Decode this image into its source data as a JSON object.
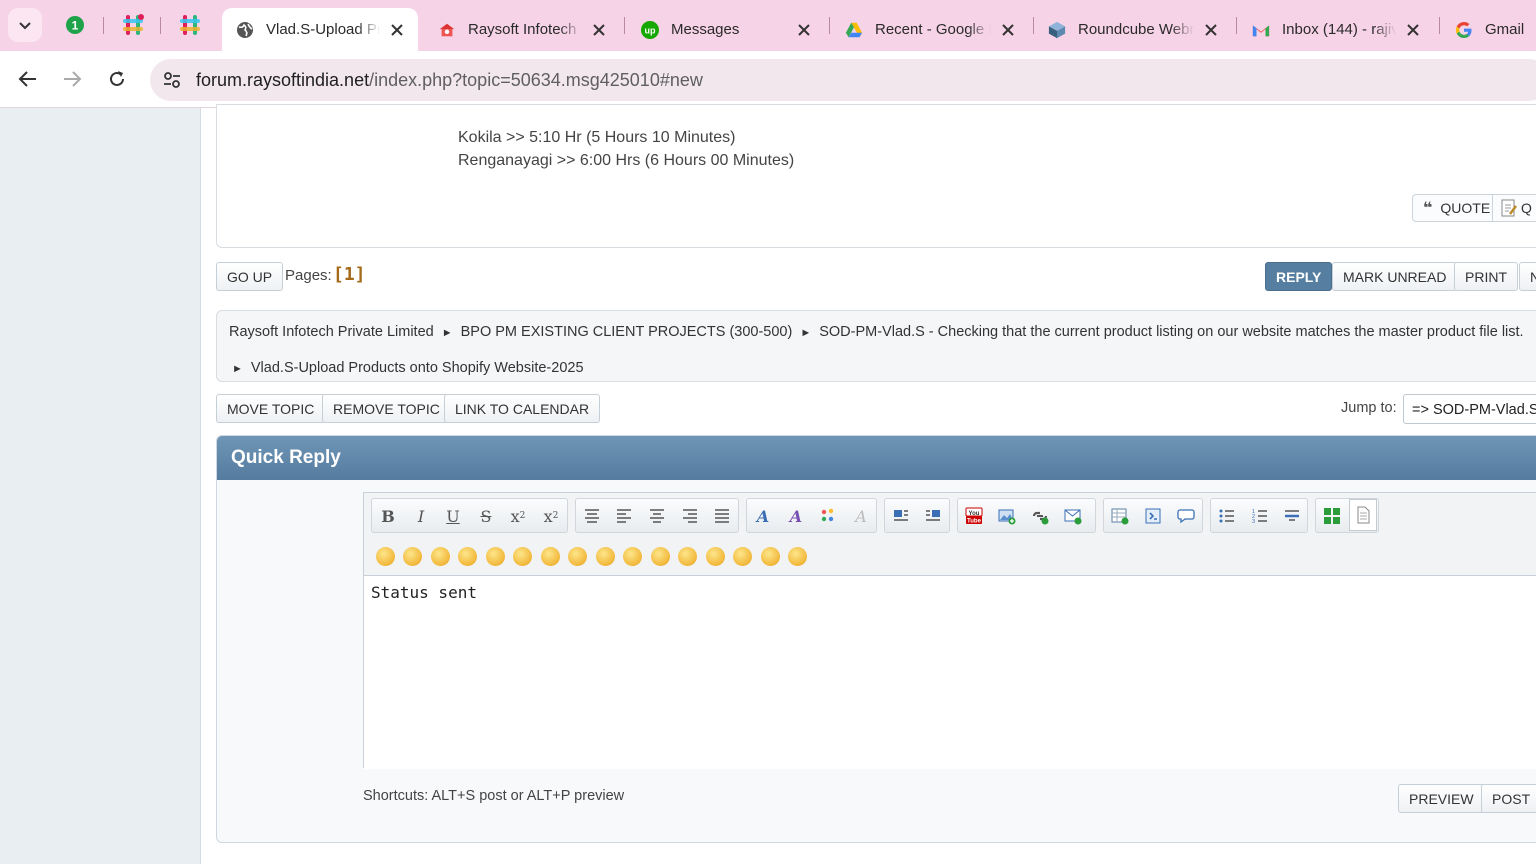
{
  "browser": {
    "tabs": [
      {
        "title": "Vlad.S-Upload Pr",
        "favicon": "globe-icon",
        "active": true
      },
      {
        "title": "Raysoft Infotech I",
        "favicon": "raysoft-icon"
      },
      {
        "title": "Messages",
        "favicon": "upwork-icon"
      },
      {
        "title": "Recent - Google D",
        "favicon": "drive-icon"
      },
      {
        "title": "Roundcube Webr",
        "favicon": "roundcube-icon"
      },
      {
        "title": "Inbox (144) - rajiv",
        "favicon": "gmail-icon"
      },
      {
        "title": "Gmail",
        "favicon": "google-icon"
      }
    ],
    "url_host": "forum.raysoftindia.net",
    "url_rest": "/index.php?topic=50634.msg425010#new"
  },
  "post": {
    "lines": [
      "Kokila >>  5:10 Hr (5 Hours 10 Minutes)",
      "Renganayagi >> 6:00 Hrs (6 Hours 00 Minutes)"
    ],
    "quote_label": "QUOTE",
    "quote2_label": "Q"
  },
  "nav": {
    "go_up": "GO UP",
    "pages_label": "Pages:",
    "pages_value": "[1]",
    "reply": "REPLY",
    "mark_unread": "MARK UNREAD",
    "print": "PRINT",
    "more": "N"
  },
  "breadcrumb": {
    "items": [
      "Raysoft Infotech Private Limited",
      "BPO PM EXISTING CLIENT PROJECTS (300-500)",
      "SOD-PM-Vlad.S - Checking that the current product listing on our website matches the master product file list."
    ],
    "last": "Vlad.S-Upload Products onto Shopify Website-2025"
  },
  "moderation": {
    "move_topic": "MOVE TOPIC",
    "remove_topic": "REMOVE TOPIC",
    "link_calendar": "LINK TO CALENDAR",
    "jump_label": "Jump to:",
    "jump_value": "=> SOD-PM-Vlad.S"
  },
  "quick_reply": {
    "title": "Quick Reply",
    "message": "Status sent",
    "shortcuts": "Shortcuts: ALT+S post or ALT+P preview",
    "preview": "PREVIEW",
    "post": "POST"
  },
  "colors": {
    "tabstrip": "#f6d3e6",
    "header_blue": "#557c9f",
    "pages_number": "#a46a1a"
  }
}
